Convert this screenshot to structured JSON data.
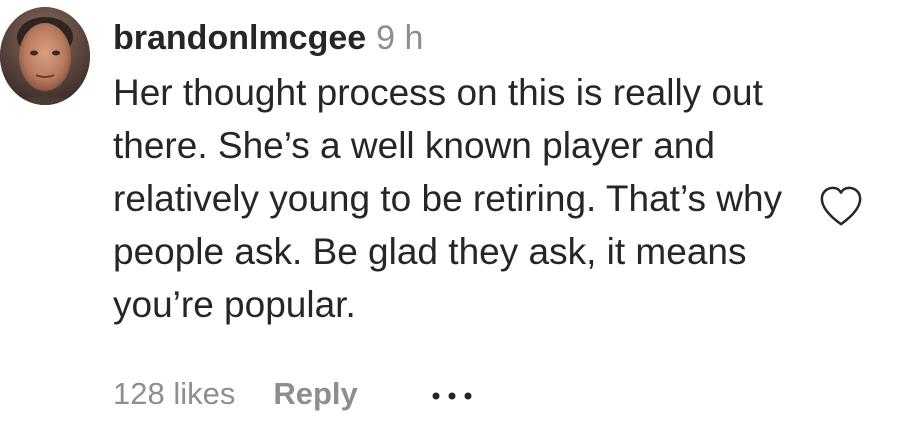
{
  "comment": {
    "username": "brandonlmcgee",
    "time": "9 h",
    "text": "Her thought process on this is really out there. She’s a well known player and relatively young to be retiring. That’s why people ask. Be glad they ask, it means you’re popular.",
    "likes": "128 likes",
    "reply_label": "Reply",
    "more_icon": "more-options-icon",
    "like_icon": "heart-outline-icon",
    "avatar_icon": "user-avatar"
  },
  "colors": {
    "text": "#262626",
    "secondary": "#8e8e8e",
    "background": "#ffffff"
  }
}
